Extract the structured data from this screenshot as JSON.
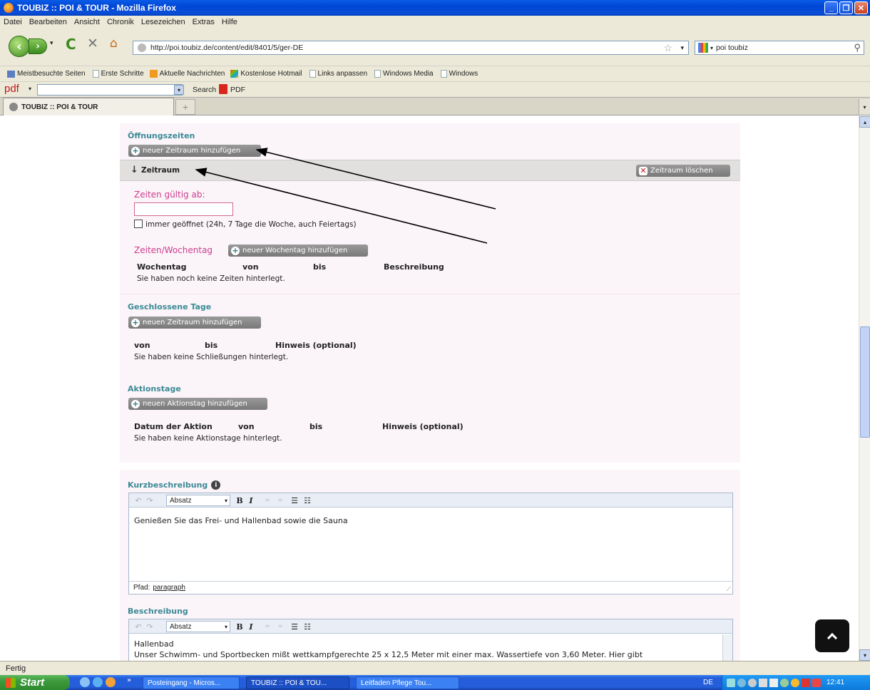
{
  "window": {
    "title": "TOUBIZ :: POI & TOUR - Mozilla Firefox"
  },
  "menu": [
    "Datei",
    "Bearbeiten",
    "Ansicht",
    "Chronik",
    "Lesezeichen",
    "Extras",
    "Hilfe"
  ],
  "nav": {
    "url": "http://poi.toubiz.de/content/edit/8401/5/ger-DE",
    "search_value": "poi toubiz"
  },
  "bookmarks": [
    "Meistbesuchte Seiten",
    "Erste Schritte",
    "Aktuelle Nachrichten",
    "Kostenlose Hotmail",
    "Links anpassen",
    "Windows Media",
    "Windows"
  ],
  "pdfbar": {
    "logo": "pdf",
    "search_label": "Search",
    "pdf_label": "PDF"
  },
  "tab": {
    "label": "TOUBIZ :: POI & TOUR"
  },
  "opening": {
    "title": "Öffnungszeiten",
    "add_period": "neuer Zeitraum hinzufügen",
    "period_label": "Zeitraum",
    "delete_period": "Zeitraum löschen",
    "valid_from": "Zeiten gültig ab:",
    "always_open": "immer geöffnet (24h, 7 Tage die Woche, auch Feiertags)",
    "weekday_title": "Zeiten/Wochentag",
    "add_weekday": "neuer Wochentag hinzufügen",
    "columns": [
      "Wochentag",
      "von",
      "bis",
      "Beschreibung"
    ],
    "empty": "Sie haben noch keine Zeiten hinterlegt."
  },
  "closed": {
    "title": "Geschlossene Tage",
    "add": "neuen Zeitraum hinzufügen",
    "columns": [
      "von",
      "bis",
      "Hinweis (optional)"
    ],
    "empty": "Sie haben keine Schließungen hinterlegt."
  },
  "action": {
    "title": "Aktionstage",
    "add": "neuen Aktionstag hinzufügen",
    "columns": [
      "Datum der Aktion",
      "von",
      "bis",
      "Hinweis (optional)"
    ],
    "empty": "Sie haben keine Aktionstage hinterlegt."
  },
  "short_desc": {
    "title": "Kurzbeschreibung",
    "format": "Absatz",
    "text": "Genießen Sie das Frei- und Hallenbad sowie die Sauna",
    "path_label": "Pfad:",
    "path_value": "paragraph"
  },
  "desc": {
    "title": "Beschreibung",
    "format": "Absatz",
    "line1": "Hallenbad",
    "line2": "Unser Schwimm- und Sportbecken mißt wettkampfgerechte 25 x 12,5 Meter mit einer max. Wassertiefe von 3,60 Meter. Hier gibt"
  },
  "status": "Fertig",
  "taskbar": {
    "start": "Start",
    "tasks": [
      "Posteingang - Micros...",
      "TOUBIZ :: POI & TOU...",
      "Leitfaden Pflege Tou..."
    ],
    "lang": "DE",
    "time": "12:41"
  },
  "colors": {
    "accent": "#3a8a96",
    "pink": "#cc3d8e",
    "panel": "#fbf4f8"
  }
}
